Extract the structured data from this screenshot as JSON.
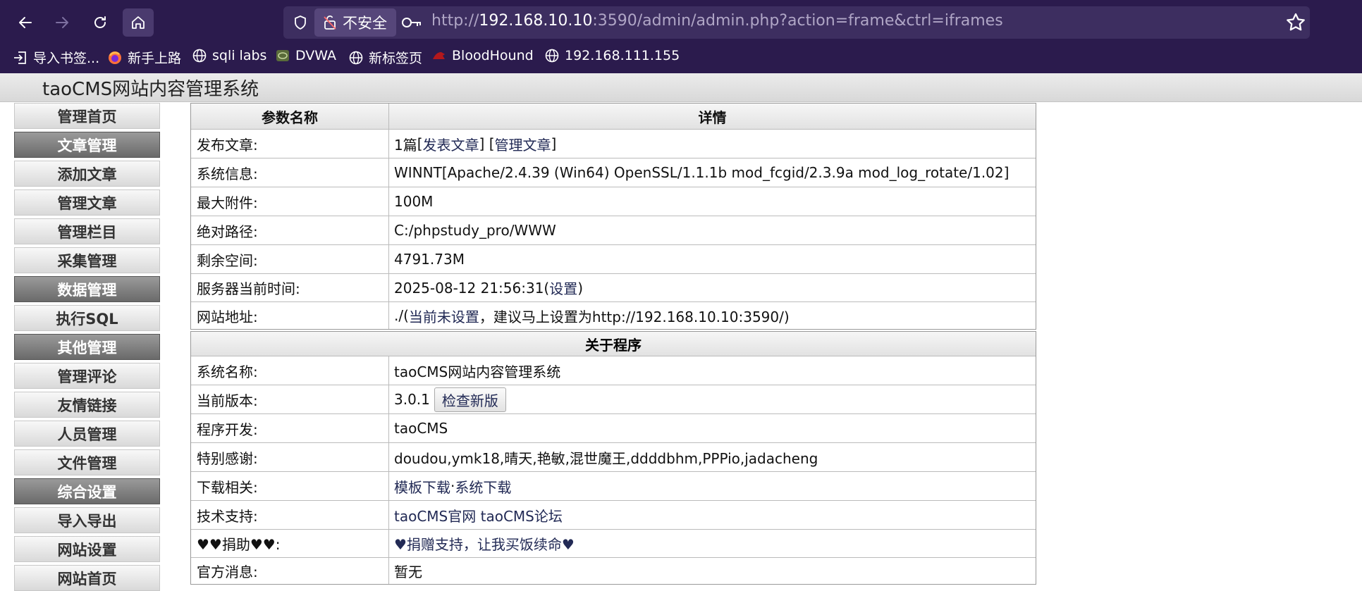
{
  "browser": {
    "url_prefix": "http://",
    "url_host": "192.168.10.10",
    "url_rest": ":3590/admin/admin.php?action=frame&ctrl=iframes",
    "insecure_label": "不安全",
    "bookmarks": [
      {
        "label": "导入书签...",
        "icon": "import-icon"
      },
      {
        "label": "新手上路",
        "icon": "firefox-icon"
      },
      {
        "label": "sqli labs",
        "icon": "globe-icon"
      },
      {
        "label": "DVWA",
        "icon": "dvwa-icon"
      },
      {
        "label": "新标签页",
        "icon": "globe-icon"
      },
      {
        "label": "BloodHound",
        "icon": "bloodhound-icon"
      },
      {
        "label": "192.168.111.155",
        "icon": "globe-icon"
      }
    ]
  },
  "site": {
    "title": "taoCMS网站内容管理系统"
  },
  "sidebar": {
    "items": [
      {
        "label": "管理首页",
        "group": false
      },
      {
        "label": "文章管理",
        "group": true
      },
      {
        "label": "添加文章",
        "group": false
      },
      {
        "label": "管理文章",
        "group": false
      },
      {
        "label": "管理栏目",
        "group": false
      },
      {
        "label": "采集管理",
        "group": false
      },
      {
        "label": "数据管理",
        "group": true
      },
      {
        "label": "执行SQL",
        "group": false
      },
      {
        "label": "其他管理",
        "group": true
      },
      {
        "label": "管理评论",
        "group": false
      },
      {
        "label": "友情链接",
        "group": false
      },
      {
        "label": "人员管理",
        "group": false
      },
      {
        "label": "文件管理",
        "group": false
      },
      {
        "label": "综合设置",
        "group": true
      },
      {
        "label": "导入导出",
        "group": false
      },
      {
        "label": "网站设置",
        "group": false
      },
      {
        "label": "网站首页",
        "group": false
      }
    ]
  },
  "params": {
    "header_name": "参数名称",
    "header_detail": "详情",
    "publish_label": "发布文章:",
    "publish_count": "1篇",
    "publish_link": "发表文章",
    "manage_link": "管理文章",
    "sysinfo_label": "系统信息:",
    "sysinfo_value": "WINNT[Apache/2.4.39 (Win64) OpenSSL/1.1.1b mod_fcgid/2.3.9a mod_log_rotate/1.02]",
    "maxattach_label": "最大附件:",
    "maxattach_value": "100M",
    "path_label": "绝对路径:",
    "path_value": "C:/phpstudy_pro/WWW",
    "space_label": "剩余空间:",
    "space_value": "4791.73M",
    "time_label": "服务器当前时间:",
    "time_value": "2025-08-12 21:56:31(",
    "time_link": "设置",
    "time_close": ")",
    "siteurl_label": "网站地址:",
    "siteurl_prefix": "./(",
    "siteurl_warn": "当前未设置",
    "siteurl_rest": "，建议马上设置为http://192.168.10.10:3590/)"
  },
  "about": {
    "section_title": "关于程序",
    "name_label": "系统名称:",
    "name_value": "taoCMS网站内容管理系统",
    "version_label": "当前版本:",
    "version_value": "3.0.1",
    "check_button": "检查新版",
    "dev_label": "程序开发:",
    "dev_value": "taoCMS",
    "thanks_label": "特别感谢:",
    "thanks_value": "doudou,ymk18,晴天,艳敏,混世魔王,ddddbhm,PPPio,jadacheng",
    "download_label": "下载相关:",
    "download_tpl": "模板下载",
    "download_sep": "·",
    "download_sys": "系统下载",
    "support_label": "技术支持:",
    "support_site": "taoCMS官网",
    "support_forum": "taoCMS论坛",
    "donate_label": "♥♥捐助♥♥:",
    "donate_value": "♥捐赠支持，让我买饭续命♥",
    "news_label": "官方消息:",
    "news_value": "暂无"
  }
}
